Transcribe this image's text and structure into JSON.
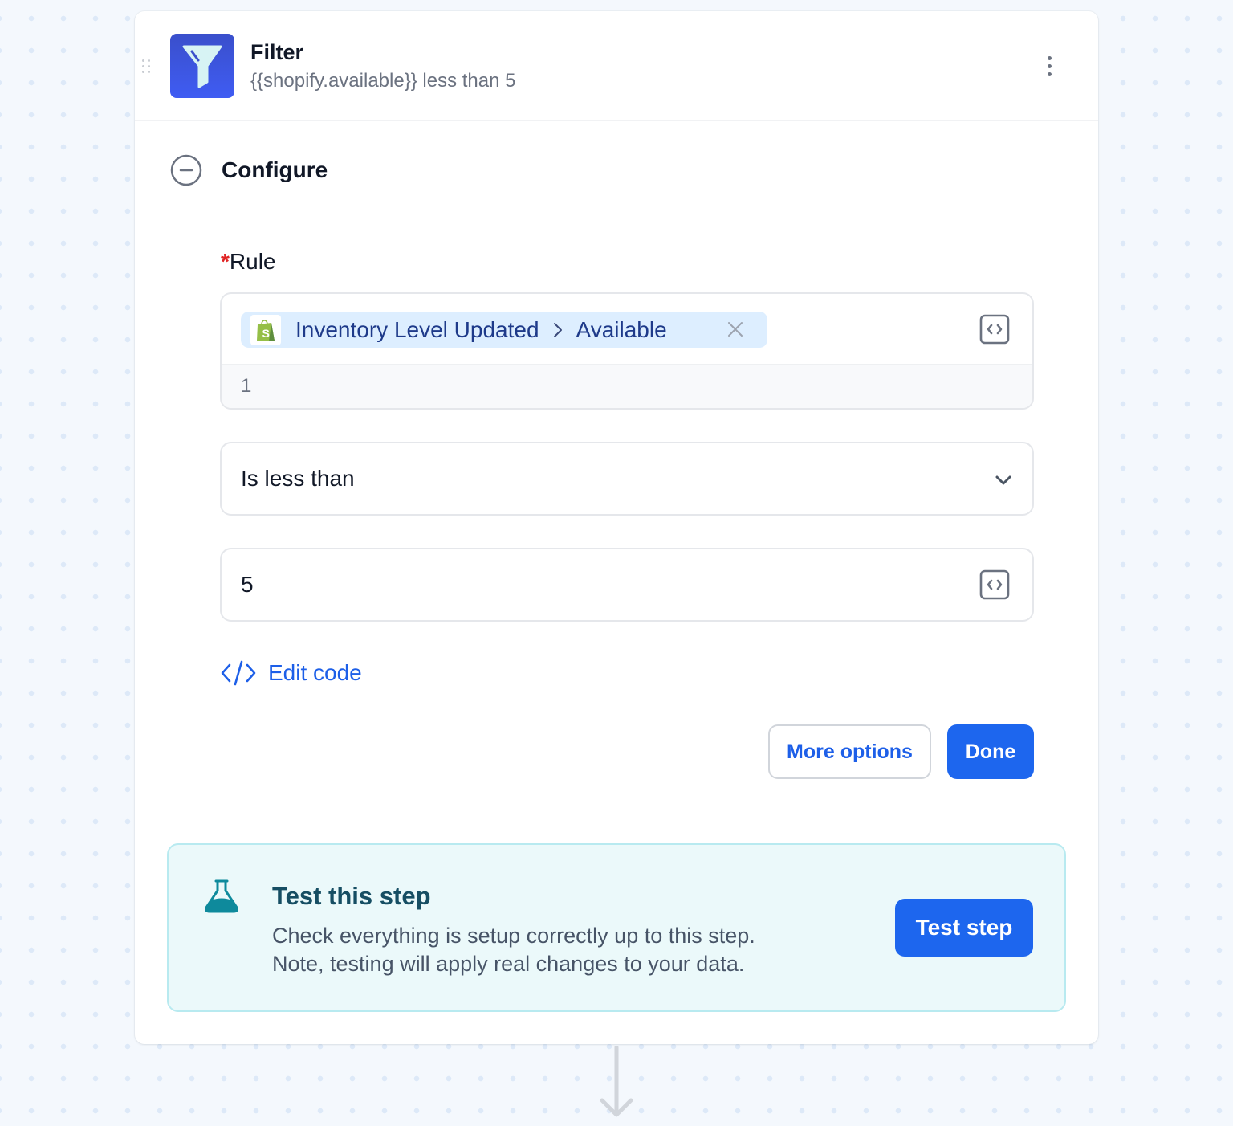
{
  "step": {
    "title": "Filter",
    "subtitle": "{{shopify.available}} less than 5",
    "icon": "filter-funnel-icon",
    "accent": "#3f5cf3"
  },
  "configure": {
    "label": "Configure",
    "state": "expanded"
  },
  "rule": {
    "label": "Rule",
    "required_mark": "*",
    "pill": {
      "app_icon": "shopify-bag-icon",
      "source": "Inventory Level Updated",
      "separator": ">",
      "field": "Available"
    },
    "preview_value": "1"
  },
  "operator": {
    "selected": "Is less than"
  },
  "value": {
    "text": "5"
  },
  "edit_code": {
    "label": "Edit code"
  },
  "actions": {
    "more_options": "More options",
    "done": "Done",
    "primary_color": "#1d66ee"
  },
  "test": {
    "title": "Test this step",
    "description_line1": "Check everything is setup correctly up to this step.",
    "description_line2": "Note, testing will apply real changes to your data.",
    "button": "Test step",
    "icon": "flask-icon"
  }
}
